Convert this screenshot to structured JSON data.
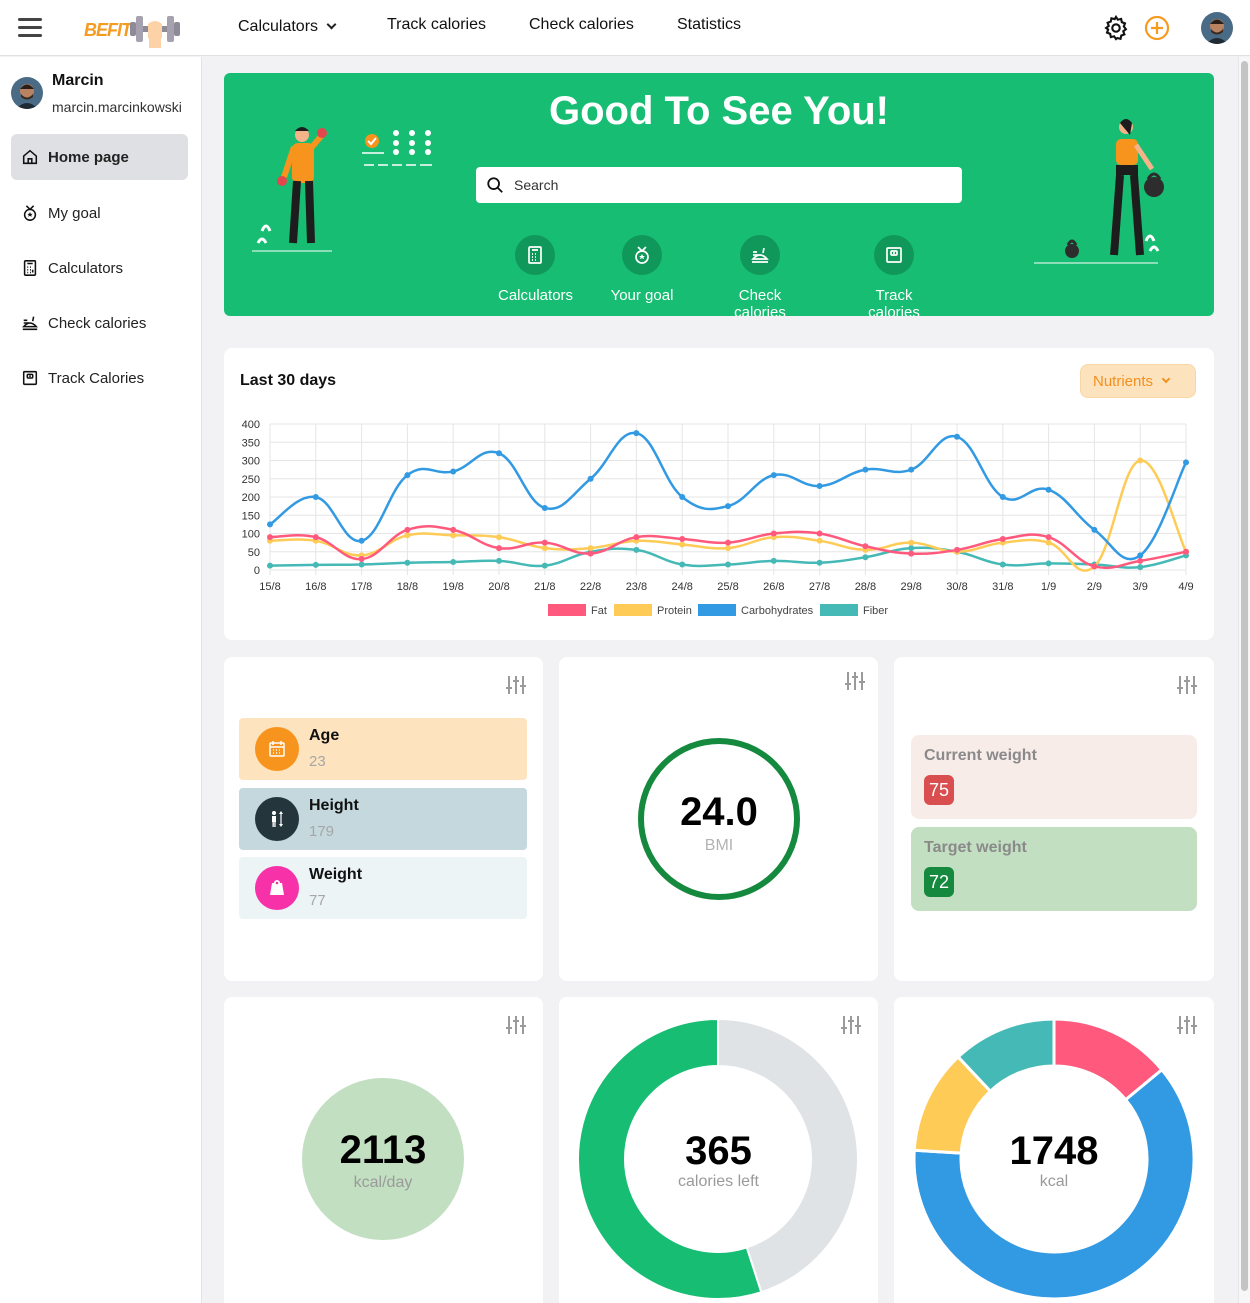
{
  "header": {
    "logo_text": "BEFIT",
    "nav": {
      "calculators": "Calculators",
      "track_calories": "Track calories",
      "check_calories": "Check calories",
      "statistics": "Statistics"
    }
  },
  "profile": {
    "name": "Marcin",
    "email": "marcin.marcinkowski"
  },
  "sidebar": {
    "items": [
      {
        "label": "Home page",
        "icon": "home-icon",
        "active": true
      },
      {
        "label": "My goal",
        "icon": "medal-icon",
        "active": false
      },
      {
        "label": "Calculators",
        "icon": "calculator-icon",
        "active": false
      },
      {
        "label": "Check calories",
        "icon": "food-tray-icon",
        "active": false
      },
      {
        "label": "Track Calories",
        "icon": "scale-icon",
        "active": false
      }
    ]
  },
  "hero": {
    "title": "Good To See You!",
    "search_placeholder": "Search",
    "quick": {
      "calculators": "Calculators",
      "your_goal": "Your goal",
      "check_calories": "Check calories",
      "track_calories": "Track calories"
    }
  },
  "chart_card": {
    "title": "Last 30 days",
    "dropdown": "Nutrients"
  },
  "chart_data": {
    "type": "line",
    "title": "",
    "xlabel": "",
    "ylabel": "",
    "ylim": [
      0,
      400
    ],
    "yticks": [
      0,
      50,
      100,
      150,
      200,
      250,
      300,
      350,
      400
    ],
    "grid": true,
    "legend": "bottom",
    "categories": [
      "15/8",
      "16/8",
      "17/8",
      "18/8",
      "19/8",
      "20/8",
      "21/8",
      "22/8",
      "23/8",
      "24/8",
      "25/8",
      "26/8",
      "27/8",
      "28/8",
      "29/8",
      "30/8",
      "31/8",
      "1/9",
      "2/9",
      "3/9",
      "4/9"
    ],
    "series": [
      {
        "name": "Fat",
        "color": "#ff5a7d",
        "values": [
          90,
          90,
          30,
          110,
          110,
          60,
          75,
          45,
          90,
          85,
          75,
          100,
          100,
          65,
          45,
          55,
          85,
          90,
          10,
          25,
          50
        ]
      },
      {
        "name": "Protein",
        "color": "#ffcb57",
        "values": [
          80,
          80,
          40,
          95,
          95,
          90,
          60,
          60,
          80,
          70,
          60,
          90,
          80,
          55,
          75,
          50,
          75,
          75,
          10,
          300,
          50
        ]
      },
      {
        "name": "Carbohydrates",
        "color": "#3299e3",
        "values": [
          125,
          200,
          80,
          260,
          270,
          320,
          170,
          250,
          375,
          200,
          175,
          260,
          230,
          275,
          275,
          365,
          200,
          220,
          110,
          40,
          295
        ]
      },
      {
        "name": "Fiber",
        "color": "#45b9b6",
        "values": [
          12,
          14,
          15,
          20,
          22,
          25,
          12,
          50,
          55,
          15,
          15,
          25,
          20,
          35,
          60,
          50,
          15,
          18,
          15,
          8,
          40
        ]
      }
    ]
  },
  "stats": {
    "age_label": "Age",
    "age_value": "23",
    "height_label": "Height",
    "height_value": "179",
    "weight_label": "Weight",
    "weight_value": "77",
    "bmi_value": "24.0",
    "bmi_label": "BMI",
    "current_weight_label": "Current weight",
    "current_weight": "75",
    "target_weight_label": "Target weight",
    "target_weight": "72",
    "kcal_day_value": "2113",
    "kcal_day_label": "kcal/day",
    "calories_left_value": "365",
    "calories_left_label": "calories left",
    "calories_left_fraction": 0.55,
    "kcal_value": "1748",
    "kcal_label": "kcal",
    "macro_shares": [
      {
        "name": "Fat",
        "color": "#ff5a7d",
        "share": 0.14
      },
      {
        "name": "Carbohydrates",
        "color": "#3299e3",
        "share": 0.62
      },
      {
        "name": "Protein",
        "color": "#ffcb57",
        "share": 0.12
      },
      {
        "name": "Fiber",
        "color": "#45b9b6",
        "share": 0.12
      }
    ]
  },
  "colors": {
    "brand_green": "#17bd72",
    "brand_orange": "#f59b1f",
    "bmi_ring": "#15893d"
  }
}
